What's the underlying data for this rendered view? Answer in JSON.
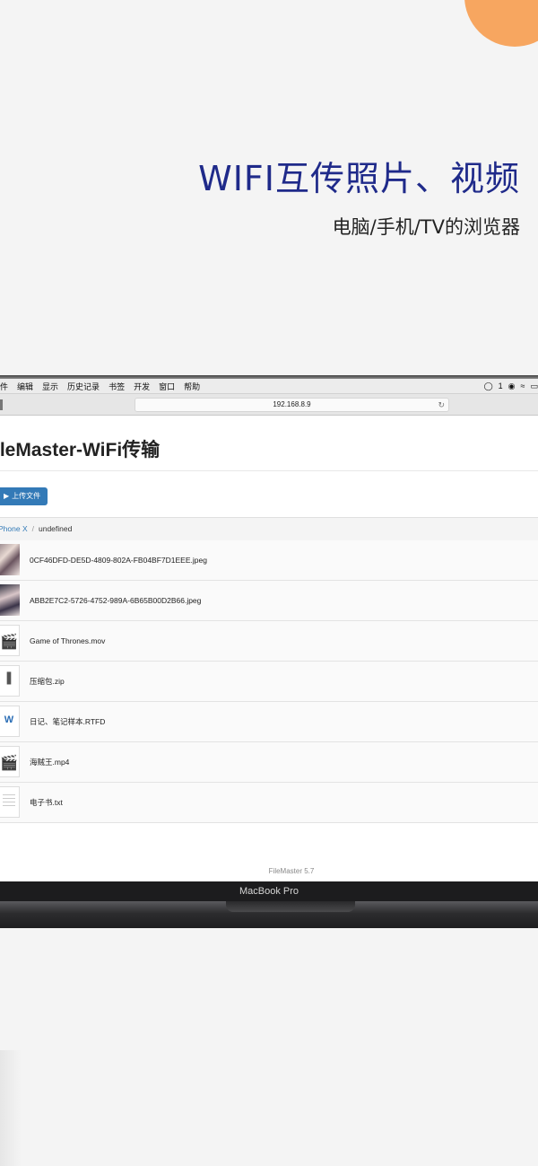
{
  "promo": {
    "headline": "WIFI互传照片、视频",
    "subline": "电脑/手机/TV的浏览器",
    "accent_color": "#1f2a8a",
    "circle_color": "#f7a660"
  },
  "menubar": {
    "items": [
      "件",
      "编辑",
      "显示",
      "历史记录",
      "书签",
      "开发",
      "窗口",
      "帮助"
    ],
    "status_count": "1"
  },
  "browser": {
    "url": "192.168.8.9"
  },
  "page": {
    "title": "ileMaster-WiFi传输",
    "upload_label": "上传文件",
    "breadcrumb_link": "Phone X",
    "breadcrumb_sep": "/",
    "breadcrumb_current": "undefined",
    "files": [
      {
        "name": "0CF46DFD-DE5D-4809-802A-FB04BF7D1EEE.jpeg",
        "icon": "photo-thumbnail"
      },
      {
        "name": "ABB2E7C2-5726-4752-989A-6B65B00D2B66.jpeg",
        "icon": "photo-thumbnail"
      },
      {
        "name": "Game of Thrones.mov",
        "icon": "clapperboard-icon"
      },
      {
        "name": "压缩包.zip",
        "icon": "zip-icon"
      },
      {
        "name": "日记、笔记样本.RTFD",
        "icon": "word-doc-icon"
      },
      {
        "name": "海贼王.mp4",
        "icon": "clapperboard-icon"
      },
      {
        "name": "电子书.txt",
        "icon": "text-doc-icon"
      }
    ],
    "footer": "FileMaster 5.7"
  },
  "laptop": {
    "model_label": "MacBook Pro"
  }
}
